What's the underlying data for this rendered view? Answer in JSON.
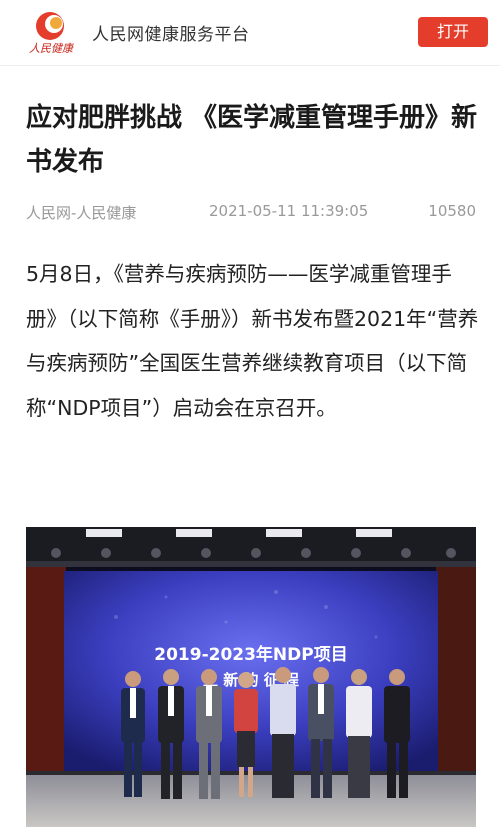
{
  "header": {
    "logo_text": "人民健康",
    "brand_name": "人民网健康服务平台",
    "open_button": "打开"
  },
  "article": {
    "title": "应对肥胖挑战 《医学减重管理手册》新书发布",
    "source": "人民网-人民健康",
    "datetime": "2021-05-11 11:39:05",
    "views": "10580",
    "body": "5月8日，《营养与疾病预防——医学减重管理手册》（以下简称《手册》）新书发布暨2021年“营养与疾病预防”全国医生营养继续教育项目（以下简称“NDP项目”）启动会在京召开。"
  },
  "photo": {
    "screen_line1": "2019-2023年NDP项目",
    "screen_line2": "上 新 的 征 程"
  },
  "colors": {
    "brand_red": "#e43d2c",
    "screen_blue": "#3b3fc0"
  }
}
